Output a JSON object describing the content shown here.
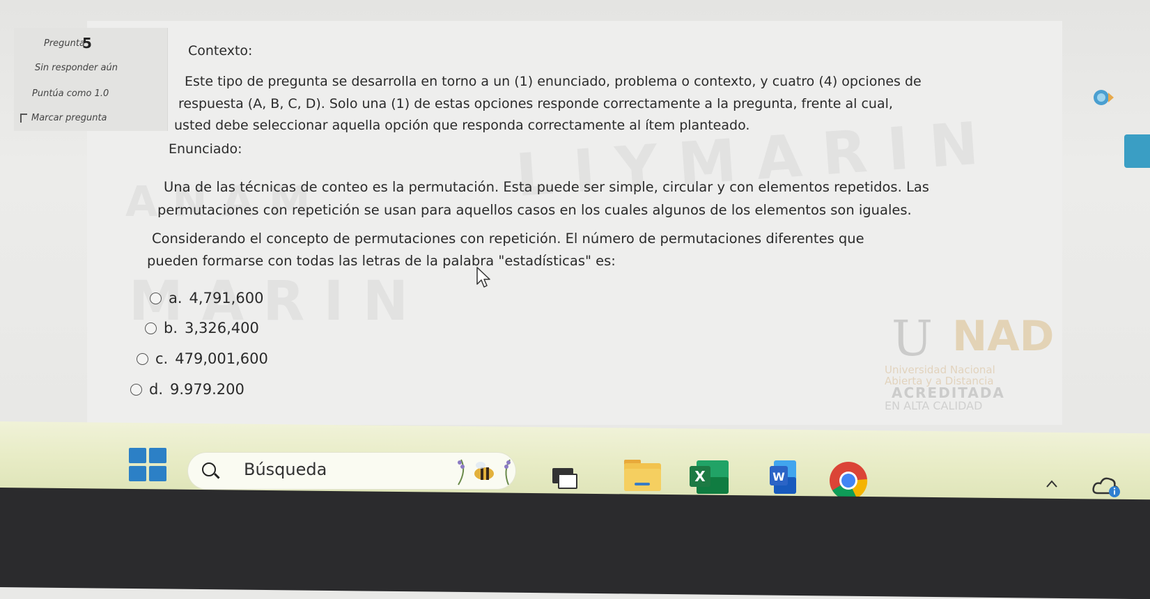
{
  "question_info": {
    "question_label": "Pregunta",
    "question_number": "5",
    "state": "Sin responder aún",
    "score": "Puntúa como 1.0",
    "flag_label": "Marcar pregunta"
  },
  "context": {
    "heading": "Contexto:",
    "lines": [
      "Este tipo de pregunta se desarrolla en torno a un (1) enunciado, problema o contexto, y cuatro (4) opciones de",
      "respuesta (A, B, C, D). Solo una (1) de estas opciones responde correctamente a la pregunta, frente al cual,",
      "usted debe seleccionar aquella opción que responda correctamente al ítem planteado."
    ]
  },
  "statement": {
    "heading": "Enunciado:",
    "lines": [
      "Una de las técnicas de conteo es la permutación. Esta puede ser simple, circular y con elementos repetidos. Las",
      "permutaciones con repetición se usan para aquellos casos en los cuales algunos de los elementos son iguales.",
      "Considerando el concepto de permutaciones con repetición. El número de permutaciones diferentes que",
      "pueden formarse con todas las letras de la palabra \"estadísticas\" es:"
    ]
  },
  "options": [
    {
      "letter": "a.",
      "value": "4,791,600"
    },
    {
      "letter": "b.",
      "value": "3,326,400"
    },
    {
      "letter": "c.",
      "value": "479,001,600"
    },
    {
      "letter": "d.",
      "value": "9.979.200"
    }
  ],
  "taskbar": {
    "search_label": "Búsqueda",
    "excel_letter": "X",
    "word_letter": "W"
  },
  "colors": {
    "taskbar_bg": "#e8ecc6",
    "start_blue": "#2c80c6",
    "side_tab": "#3a9ec4",
    "excel_green": "#1d7a44",
    "word_blue": "#2b64c6"
  }
}
